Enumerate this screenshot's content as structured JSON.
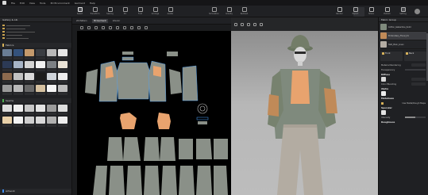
{
  "menubar": {
    "items": [
      "File",
      "Edit",
      "View",
      "Tools",
      "3D Environment",
      "Garment",
      "Help"
    ]
  },
  "toolbar": {
    "left": [
      {
        "label": "Select",
        "icon": "cursor-icon",
        "active": true
      },
      {
        "label": "Transform",
        "icon": "transform-icon"
      },
      {
        "label": "Sewing",
        "icon": "sewing-icon"
      },
      {
        "label": "Pin",
        "icon": "pin-icon"
      },
      {
        "label": "Fold",
        "icon": "fold-icon"
      },
      {
        "label": "Arrange",
        "icon": "arrange-icon"
      },
      {
        "label": "Avatar",
        "icon": "avatar-icon"
      }
    ],
    "center": [
      {
        "label": "Simulation",
        "icon": "play-icon"
      },
      {
        "label": "Gravity",
        "icon": "gravity-icon"
      },
      {
        "label": "Remesh",
        "icon": "remesh-icon"
      }
    ],
    "right": [
      {
        "label": "Render",
        "icon": "render-icon"
      },
      {
        "label": "Export",
        "icon": "export-icon"
      },
      {
        "label": "Share",
        "icon": "share-icon"
      },
      {
        "label": "Publish",
        "icon": "publish-icon"
      },
      {
        "label": "Setting",
        "icon": "gear-icon"
      }
    ]
  },
  "left_panel": {
    "library_title": "Gallery & Lib",
    "fabrics_title": "Fabrics",
    "seams_title": "Seams",
    "artwork_title": "Artwork",
    "fabric_colors": [
      "#6a7d94",
      "#34527c",
      "#c49a6c",
      "#3a3d42",
      "#b9b9b9",
      "#e7e7e7",
      "#2c3a55",
      "#a7b4c6",
      "#d4d4d4",
      "#f1f1f1",
      "#7c8084",
      "#e9e2d6",
      "#8c6a4e",
      "#c2c2c2",
      "#dadada",
      "#1d1d1d",
      "#cfd4da",
      "#ededed",
      "#9a9a9a",
      "#b8b8b8",
      "#686868",
      "#d6c1a0",
      "#f5f5f5",
      "#bcbcbc"
    ],
    "seam_colors": [
      "#dcdcdc",
      "#f0f0f0",
      "#c7c7c7",
      "#e3e3e3",
      "#9b9b9b",
      "#dedede",
      "#e8d0a8",
      "#f3f3f3",
      "#cfcfcf",
      "#d9d9d9",
      "#b0b0b0",
      "#ededed"
    ]
  },
  "viewport2d": {
    "tabs": [
      "2D Pattern",
      "3D Garment",
      "Interior"
    ],
    "active_tab": "3D Garment"
  },
  "right_panel": {
    "object_browser_title": "Fabric Group",
    "fabrics": [
      {
        "name": "Cotton_Gabardine_Solid",
        "color": "#7f8a7d"
      },
      {
        "name": "Embroidery_Floral_01",
        "color": "#c08a58"
      },
      {
        "name": "Twill_Plain_Linen",
        "color": "#b3aca2"
      }
    ],
    "selected_index": 1,
    "tabs": [
      "Front",
      "Back"
    ],
    "props": {
      "material_section": "Material Rendering",
      "transparency": "Transparency",
      "diffuse": "Diffuse",
      "color_blending": "Color Blending",
      "alpha": "Alpha",
      "metalness": "Metalness",
      "use_metal": "Use Metal/Rough Maps",
      "specular": "Specular",
      "intensity": "Intensity",
      "roughness": "Roughness"
    }
  },
  "colors": {
    "accent": "#d8b25a",
    "panel": "#1f2023",
    "viewport2d_bg": "#000000",
    "pattern_piece": "#8a9088",
    "pattern_accent": "#e8a36e",
    "seam_line": "#4aa3ff"
  }
}
